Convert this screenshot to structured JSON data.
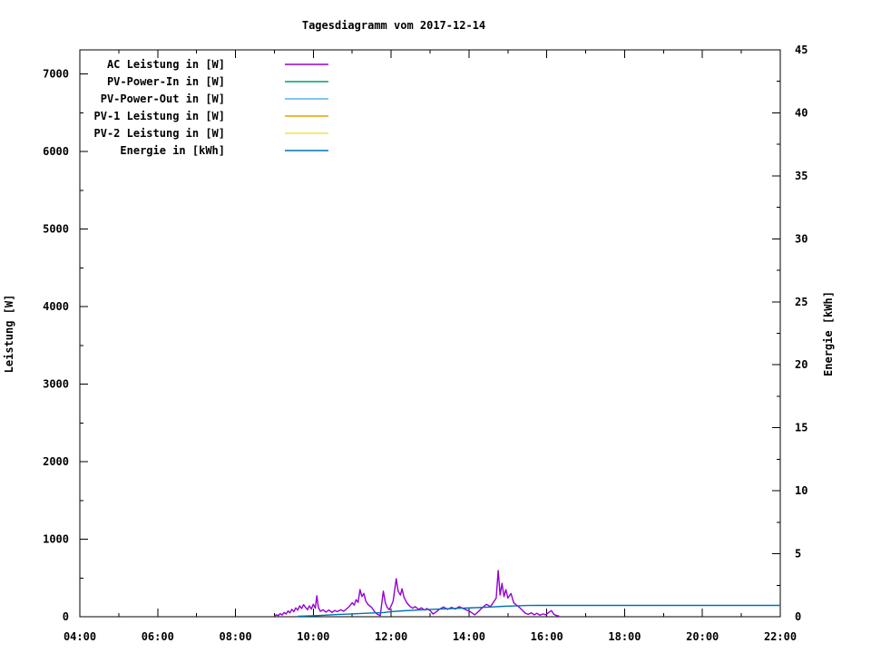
{
  "chart_data": {
    "type": "line",
    "title": "Tagesdiagramm vom 2017-12-14",
    "ylabel": "Leistung [W]",
    "y2label": "Energie [kWh]",
    "x_axis": {
      "unit": "time",
      "range_hours": [
        4,
        22
      ],
      "major_ticks": [
        {
          "label": "04:00",
          "hour": 4
        },
        {
          "label": "06:00",
          "hour": 6
        },
        {
          "label": "08:00",
          "hour": 8
        },
        {
          "label": "10:00",
          "hour": 10
        },
        {
          "label": "12:00",
          "hour": 12
        },
        {
          "label": "14:00",
          "hour": 14
        },
        {
          "label": "16:00",
          "hour": 16
        },
        {
          "label": "18:00",
          "hour": 18
        },
        {
          "label": "20:00",
          "hour": 20
        },
        {
          "label": "22:00",
          "hour": 22
        }
      ],
      "minor_tick_hours": [
        5,
        7,
        9,
        11,
        13,
        15,
        17,
        19,
        21
      ]
    },
    "y_axis": {
      "range": [
        0,
        7310
      ],
      "major_ticks": [
        0,
        1000,
        2000,
        3000,
        4000,
        5000,
        6000,
        7000
      ],
      "minor_ticks": [
        500,
        1500,
        2500,
        3500,
        4500,
        5500,
        6500
      ]
    },
    "y2_axis": {
      "range": [
        0,
        45
      ],
      "major_ticks": [
        0,
        5,
        10,
        15,
        20,
        25,
        30,
        35,
        40,
        45
      ],
      "minor_ticks": [
        2.5,
        7.5,
        12.5,
        17.5,
        22.5,
        27.5,
        32.5,
        37.5,
        42.5
      ]
    },
    "grid": "off",
    "legend_position": "top-left-inside",
    "series": [
      {
        "name": "AC Leistung in [W]",
        "color": "#9400D3",
        "axis": "y1",
        "points": [
          [
            9.0,
            8
          ],
          [
            9.05,
            25
          ],
          [
            9.1,
            15
          ],
          [
            9.15,
            40
          ],
          [
            9.2,
            22
          ],
          [
            9.25,
            55
          ],
          [
            9.3,
            35
          ],
          [
            9.35,
            75
          ],
          [
            9.4,
            50
          ],
          [
            9.45,
            95
          ],
          [
            9.5,
            65
          ],
          [
            9.55,
            115
          ],
          [
            9.6,
            85
          ],
          [
            9.65,
            140
          ],
          [
            9.7,
            105
          ],
          [
            9.75,
            155
          ],
          [
            9.8,
            120
          ],
          [
            9.85,
            90
          ],
          [
            9.9,
            140
          ],
          [
            9.95,
            100
          ],
          [
            10.0,
            160
          ],
          [
            10.05,
            110
          ],
          [
            10.09,
            270
          ],
          [
            10.13,
            120
          ],
          [
            10.18,
            70
          ],
          [
            10.25,
            90
          ],
          [
            10.32,
            60
          ],
          [
            10.4,
            85
          ],
          [
            10.48,
            55
          ],
          [
            10.55,
            80
          ],
          [
            10.62,
            65
          ],
          [
            10.7,
            90
          ],
          [
            10.78,
            70
          ],
          [
            10.85,
            100
          ],
          [
            10.92,
            130
          ],
          [
            11.0,
            180
          ],
          [
            11.05,
            150
          ],
          [
            11.1,
            220
          ],
          [
            11.15,
            185
          ],
          [
            11.2,
            350
          ],
          [
            11.25,
            260
          ],
          [
            11.3,
            300
          ],
          [
            11.35,
            200
          ],
          [
            11.42,
            150
          ],
          [
            11.5,
            120
          ],
          [
            11.58,
            60
          ],
          [
            11.65,
            30
          ],
          [
            11.72,
            15
          ],
          [
            11.8,
            330
          ],
          [
            11.85,
            180
          ],
          [
            11.9,
            120
          ],
          [
            11.95,
            90
          ],
          [
            12.0,
            140
          ],
          [
            12.05,
            200
          ],
          [
            12.13,
            490
          ],
          [
            12.18,
            330
          ],
          [
            12.24,
            280
          ],
          [
            12.28,
            360
          ],
          [
            12.33,
            250
          ],
          [
            12.4,
            180
          ],
          [
            12.47,
            140
          ],
          [
            12.55,
            110
          ],
          [
            12.62,
            130
          ],
          [
            12.7,
            95
          ],
          [
            12.78,
            115
          ],
          [
            12.85,
            85
          ],
          [
            12.92,
            105
          ],
          [
            13.0,
            80
          ],
          [
            13.08,
            35
          ],
          [
            13.15,
            60
          ],
          [
            13.25,
            100
          ],
          [
            13.35,
            125
          ],
          [
            13.45,
            95
          ],
          [
            13.55,
            120
          ],
          [
            13.65,
            100
          ],
          [
            13.75,
            130
          ],
          [
            13.85,
            105
          ],
          [
            13.95,
            85
          ],
          [
            14.05,
            60
          ],
          [
            14.15,
            25
          ],
          [
            14.25,
            70
          ],
          [
            14.35,
            120
          ],
          [
            14.45,
            160
          ],
          [
            14.55,
            130
          ],
          [
            14.62,
            180
          ],
          [
            14.7,
            240
          ],
          [
            14.75,
            595
          ],
          [
            14.8,
            280
          ],
          [
            14.85,
            430
          ],
          [
            14.9,
            260
          ],
          [
            14.95,
            350
          ],
          [
            15.0,
            240
          ],
          [
            15.08,
            300
          ],
          [
            15.15,
            180
          ],
          [
            15.22,
            150
          ],
          [
            15.3,
            120
          ],
          [
            15.38,
            80
          ],
          [
            15.45,
            45
          ],
          [
            15.52,
            30
          ],
          [
            15.6,
            50
          ],
          [
            15.68,
            25
          ],
          [
            15.75,
            45
          ],
          [
            15.82,
            20
          ],
          [
            15.9,
            35
          ],
          [
            15.98,
            25
          ],
          [
            16.05,
            55
          ],
          [
            16.12,
            80
          ],
          [
            16.18,
            30
          ],
          [
            16.25,
            15
          ],
          [
            16.32,
            8
          ]
        ]
      },
      {
        "name": "PV-Power-In in [W]",
        "color": "#009E73",
        "axis": "y1",
        "points": []
      },
      {
        "name": "PV-Power-Out in [W]",
        "color": "#56B4E9",
        "axis": "y1",
        "points": []
      },
      {
        "name": "PV-1 Leistung in [W]",
        "color": "#E69F00",
        "axis": "y1",
        "points": []
      },
      {
        "name": "PV-2 Leistung in [W]",
        "color": "#F0E442",
        "axis": "y1",
        "points": []
      },
      {
        "name": "Energie in [kWh]",
        "color": "#0072B2",
        "axis": "y2",
        "points": [
          [
            9.6,
            0.04
          ],
          [
            10.0,
            0.08
          ],
          [
            10.3,
            0.12
          ],
          [
            10.6,
            0.17
          ],
          [
            11.0,
            0.22
          ],
          [
            11.4,
            0.28
          ],
          [
            11.8,
            0.33
          ],
          [
            12.0,
            0.4
          ],
          [
            12.3,
            0.47
          ],
          [
            12.6,
            0.52
          ],
          [
            13.0,
            0.58
          ],
          [
            13.4,
            0.63
          ],
          [
            13.8,
            0.68
          ],
          [
            14.2,
            0.72
          ],
          [
            14.6,
            0.78
          ],
          [
            14.9,
            0.83
          ],
          [
            15.2,
            0.86
          ],
          [
            15.5,
            0.89
          ],
          [
            15.8,
            0.9
          ],
          [
            22.0,
            0.9
          ]
        ]
      }
    ]
  }
}
